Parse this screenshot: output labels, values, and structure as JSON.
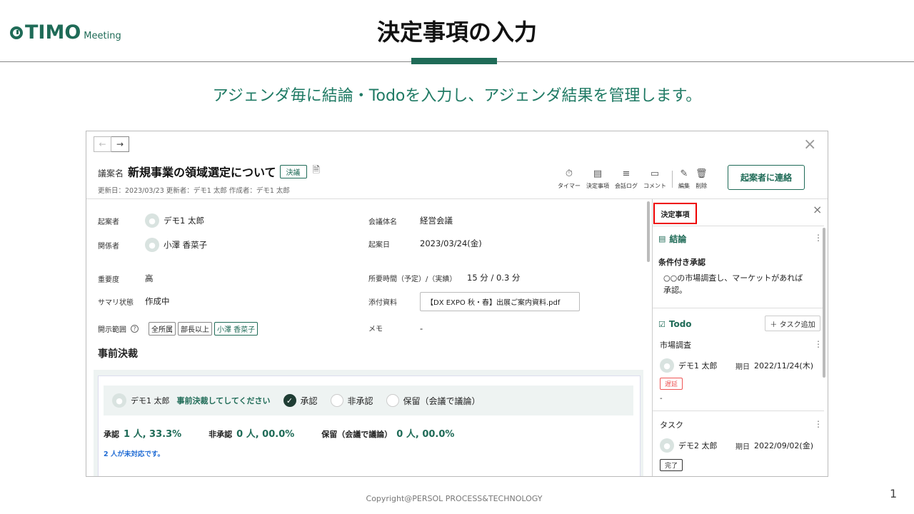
{
  "slide": {
    "logo_main": "TIMO",
    "logo_sub": "Meeting",
    "title": "決定事項の入力",
    "subtitle": "アジェンダ毎に結論・Todoを入力し、アジェンダ結果を管理します。",
    "copyright": "Copyright@PERSOL PROCESS&TECHNOLOGY",
    "page_number": "1"
  },
  "app": {
    "nav": {
      "prev": "←",
      "next": "→"
    },
    "close": "×",
    "agenda_label": "議案名",
    "agenda_name": "新規事業の領域選定について",
    "agenda_badge": "決議",
    "meta": "更新日：2023/03/23  更新者：デモ1 太郎  作成者：デモ1 太郎",
    "toolbar": [
      {
        "icon": "timer-off-icon",
        "glyph": "⏱",
        "label": "タイマー"
      },
      {
        "icon": "decision-icon",
        "glyph": "▤",
        "label": "決定事項"
      },
      {
        "icon": "log-icon",
        "glyph": "≡",
        "label": "会話ログ"
      },
      {
        "icon": "comment-icon",
        "glyph": "▭",
        "label": "コメント"
      },
      {
        "icon": "edit-icon",
        "glyph": "✎",
        "label": "編集"
      },
      {
        "icon": "delete-icon",
        "glyph": "🗑",
        "label": "削除"
      }
    ],
    "contact_button": "起案者に連絡",
    "fields": {
      "proposer_label": "起案者",
      "proposer": "デモ1 太郎",
      "related_label": "関係者",
      "related": "小澤 香菜子",
      "meeting_label": "会議体名",
      "meeting": "経営会議",
      "date_label": "起案日",
      "date": "2023/03/24(金)",
      "importance_label": "重要度",
      "importance": "高",
      "time_label": "所要時間（予定）/（実績）",
      "time": "15 分 / 0.3 分",
      "summary_label": "サマリ状態",
      "summary": "作成中",
      "attach_label": "添付資料",
      "attach": "【DX EXPO 秋・春】出展ご案内資料.pdf",
      "scope_label": "開示範囲",
      "scope_tags": [
        "全所属",
        "部長以上",
        "小澤 香菜子"
      ],
      "memo_label": "メモ",
      "memo": "-"
    },
    "prior": {
      "section_title": "事前決裁",
      "approver": "デモ1 太郎",
      "prompt": "事前決裁してしてください",
      "options": [
        "承認",
        "非承認",
        "保留（会議で議論）"
      ],
      "stats": [
        {
          "label": "承認",
          "value": "1 人, 33.3%"
        },
        {
          "label": "非承認",
          "value": "0 人, 00.0%"
        },
        {
          "label": "保留（会議で議論）",
          "value": "0 人, 00.0%"
        }
      ],
      "pending": "2 人が未対応です。"
    },
    "panel": {
      "title": "決定事項",
      "conclusion_title": "結論",
      "conclusion_head": "条件付き承認",
      "conclusion_body_1": "○○の市場調査し、マーケットがあれば",
      "conclusion_body_2": "承認。",
      "todo_title": "Todo",
      "task_add": "＋ タスク追加",
      "tasks": [
        {
          "name": "市場調査",
          "assignee": "デモ1 太郎",
          "due_label": "期日",
          "due": "2022/11/24(木)",
          "status": "遅延",
          "memo": "-"
        },
        {
          "name": "タスク",
          "assignee": "デモ2 太郎",
          "due_label": "期日",
          "due": "2022/09/02(金)",
          "status": "完了"
        }
      ]
    }
  },
  "colors": {
    "brand": "#1f6b57",
    "highlight": "#e00000",
    "late": "#e55555",
    "link": "#1f6bd4"
  }
}
